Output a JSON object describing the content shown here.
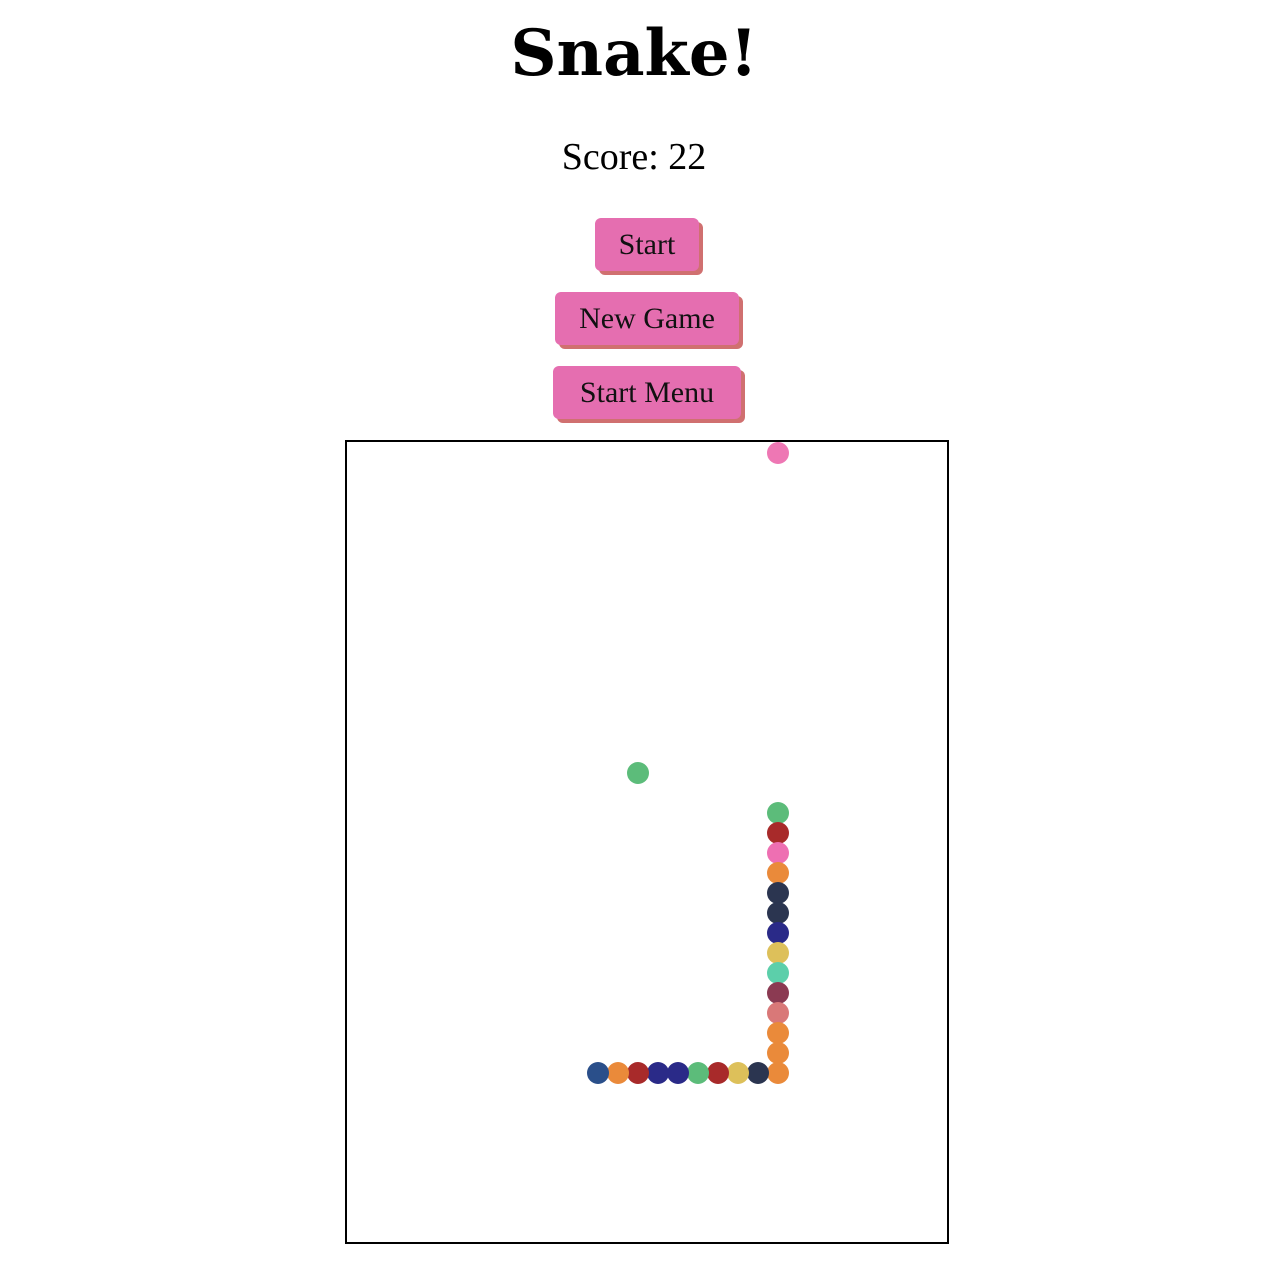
{
  "title": "Snake!",
  "score_label": "Score: 22",
  "score_value": 22,
  "buttons": {
    "start": "Start",
    "new_game": "New Game",
    "start_menu": "Start Menu"
  },
  "colors": {
    "button": "#e56eb0",
    "button_shadow": "#d07070",
    "board_border": "#000000"
  },
  "game": {
    "grid_cell": "20",
    "bonus_food": {
      "col": 21,
      "row": 0,
      "color": "#ee77b4"
    },
    "food": {
      "col": 14,
      "row": 16,
      "color": "#5cbc7a"
    },
    "snake": [
      {
        "col": 21,
        "row": 18,
        "color": "#5cbc7a"
      },
      {
        "col": 21,
        "row": 19,
        "color": "#a82a2a"
      },
      {
        "col": 21,
        "row": 20,
        "color": "#ee6fb2"
      },
      {
        "col": 21,
        "row": 21,
        "color": "#ea8a3a"
      },
      {
        "col": 21,
        "row": 22,
        "color": "#2b3550"
      },
      {
        "col": 21,
        "row": 23,
        "color": "#2b3550"
      },
      {
        "col": 21,
        "row": 24,
        "color": "#2a2a88"
      },
      {
        "col": 21,
        "row": 25,
        "color": "#ddc05a"
      },
      {
        "col": 21,
        "row": 26,
        "color": "#5ccfaa"
      },
      {
        "col": 21,
        "row": 27,
        "color": "#8b3a52"
      },
      {
        "col": 21,
        "row": 28,
        "color": "#d97878"
      },
      {
        "col": 21,
        "row": 29,
        "color": "#ea8a3a"
      },
      {
        "col": 21,
        "row": 30,
        "color": "#ea8a3a"
      },
      {
        "col": 21,
        "row": 31,
        "color": "#ea8a3a"
      },
      {
        "col": 20,
        "row": 31,
        "color": "#2b3550"
      },
      {
        "col": 19,
        "row": 31,
        "color": "#ddc05a"
      },
      {
        "col": 18,
        "row": 31,
        "color": "#a82a2a"
      },
      {
        "col": 17,
        "row": 31,
        "color": "#5cbc7a"
      },
      {
        "col": 16,
        "row": 31,
        "color": "#2a2a88"
      },
      {
        "col": 15,
        "row": 31,
        "color": "#2a2a88"
      },
      {
        "col": 14,
        "row": 31,
        "color": "#a82a2a"
      },
      {
        "col": 13,
        "row": 31,
        "color": "#ea8a3a"
      },
      {
        "col": 12,
        "row": 31,
        "color": "#2a4f8a"
      }
    ]
  }
}
